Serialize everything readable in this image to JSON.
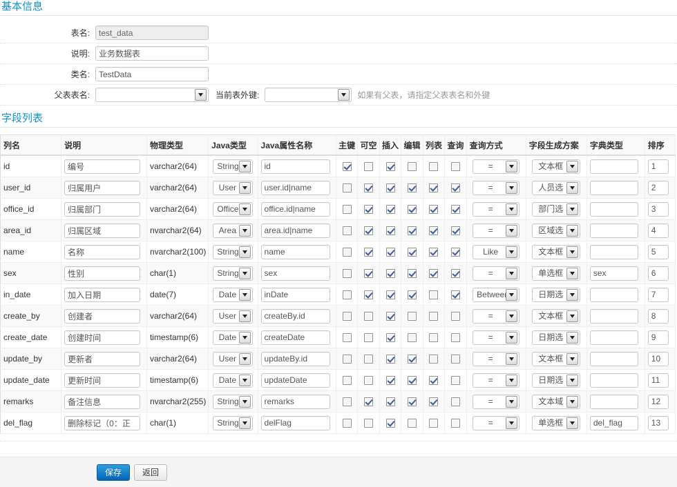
{
  "basic": {
    "legend": "基本信息",
    "rows": [
      {
        "label": "表名:",
        "value": "test_data",
        "readonly": true
      },
      {
        "label": "说明:",
        "value": "业务数据表",
        "readonly": false
      },
      {
        "label": "类名:",
        "value": "TestData",
        "readonly": false
      }
    ],
    "parent": {
      "label": "父表表名:",
      "value": "",
      "fk_label": "当前表外键:",
      "fk_value": "",
      "hint": "如果有父表，请指定父表表名和外键"
    }
  },
  "fields": {
    "legend": "字段列表",
    "columns": [
      "列名",
      "说明",
      "物理类型",
      "Java类型",
      "Java属性名称",
      "主键",
      "可空",
      "插入",
      "编辑",
      "列表",
      "查询",
      "查询方式",
      "字段生成方案",
      "字典类型",
      "排序"
    ],
    "rows": [
      {
        "name": "id",
        "comment": "编号",
        "jdbc": "varchar2(64)",
        "javaType": "String",
        "javaField": "id",
        "pk": true,
        "nullable": false,
        "insert": true,
        "edit": false,
        "list": false,
        "query": false,
        "queryType": "=",
        "showType": "文本框",
        "dictType": "",
        "sort": "1"
      },
      {
        "name": "user_id",
        "comment": "归属用户",
        "jdbc": "varchar2(64)",
        "javaType": "User",
        "javaField": "user.id|name",
        "pk": false,
        "nullable": true,
        "insert": true,
        "edit": true,
        "list": true,
        "query": true,
        "queryType": "=",
        "showType": "人员选",
        "dictType": "",
        "sort": "2"
      },
      {
        "name": "office_id",
        "comment": "归属部门",
        "jdbc": "varchar2(64)",
        "javaType": "Office",
        "javaField": "office.id|name",
        "pk": false,
        "nullable": true,
        "insert": true,
        "edit": true,
        "list": true,
        "query": true,
        "queryType": "=",
        "showType": "部门选",
        "dictType": "",
        "sort": "3"
      },
      {
        "name": "area_id",
        "comment": "归属区域",
        "jdbc": "nvarchar2(64)",
        "javaType": "Area",
        "javaField": "area.id|name",
        "pk": false,
        "nullable": true,
        "insert": true,
        "edit": true,
        "list": true,
        "query": true,
        "queryType": "=",
        "showType": "区域选",
        "dictType": "",
        "sort": "4"
      },
      {
        "name": "name",
        "comment": "名称",
        "jdbc": "nvarchar2(100)",
        "javaType": "String",
        "javaField": "name",
        "pk": false,
        "nullable": true,
        "insert": true,
        "edit": true,
        "list": true,
        "query": true,
        "queryType": "Like",
        "showType": "文本框",
        "dictType": "",
        "sort": "5"
      },
      {
        "name": "sex",
        "comment": "性别",
        "jdbc": "char(1)",
        "javaType": "String",
        "javaField": "sex",
        "pk": false,
        "nullable": true,
        "insert": true,
        "edit": true,
        "list": true,
        "query": true,
        "queryType": "=",
        "showType": "单选框",
        "dictType": "sex",
        "sort": "6"
      },
      {
        "name": "in_date",
        "comment": "加入日期",
        "jdbc": "date(7)",
        "javaType": "Date",
        "javaField": "inDate",
        "pk": false,
        "nullable": true,
        "insert": true,
        "edit": true,
        "list": false,
        "query": true,
        "queryType": "Between",
        "showType": "日期选",
        "dictType": "",
        "sort": "7"
      },
      {
        "name": "create_by",
        "comment": "创建者",
        "jdbc": "varchar2(64)",
        "javaType": "User",
        "javaField": "createBy.id",
        "pk": false,
        "nullable": false,
        "insert": true,
        "edit": false,
        "list": false,
        "query": false,
        "queryType": "=",
        "showType": "文本框",
        "dictType": "",
        "sort": "8"
      },
      {
        "name": "create_date",
        "comment": "创建时间",
        "jdbc": "timestamp(6)",
        "javaType": "Date",
        "javaField": "createDate",
        "pk": false,
        "nullable": false,
        "insert": true,
        "edit": false,
        "list": false,
        "query": false,
        "queryType": "=",
        "showType": "日期选",
        "dictType": "",
        "sort": "9"
      },
      {
        "name": "update_by",
        "comment": "更新者",
        "jdbc": "varchar2(64)",
        "javaType": "User",
        "javaField": "updateBy.id",
        "pk": false,
        "nullable": false,
        "insert": true,
        "edit": true,
        "list": false,
        "query": false,
        "queryType": "=",
        "showType": "文本框",
        "dictType": "",
        "sort": "10"
      },
      {
        "name": "update_date",
        "comment": "更新时间",
        "jdbc": "timestamp(6)",
        "javaType": "Date",
        "javaField": "updateDate",
        "pk": false,
        "nullable": false,
        "insert": true,
        "edit": true,
        "list": true,
        "query": false,
        "queryType": "=",
        "showType": "日期选",
        "dictType": "",
        "sort": "11"
      },
      {
        "name": "remarks",
        "comment": "备注信息",
        "jdbc": "nvarchar2(255)",
        "javaType": "String",
        "javaField": "remarks",
        "pk": false,
        "nullable": true,
        "insert": true,
        "edit": true,
        "list": true,
        "query": false,
        "queryType": "=",
        "showType": "文本域",
        "dictType": "",
        "sort": "12"
      },
      {
        "name": "del_flag",
        "comment": "删除标记（0：正",
        "jdbc": "char(1)",
        "javaType": "String",
        "javaField": "delFlag",
        "pk": false,
        "nullable": false,
        "insert": true,
        "edit": false,
        "list": false,
        "query": false,
        "queryType": "=",
        "showType": "单选框",
        "dictType": "del_flag",
        "sort": "13"
      }
    ]
  },
  "actions": {
    "save": "保存",
    "back": "返回"
  },
  "colors": {
    "legend": "#0e90d2",
    "primary_button": "#0663b5"
  }
}
